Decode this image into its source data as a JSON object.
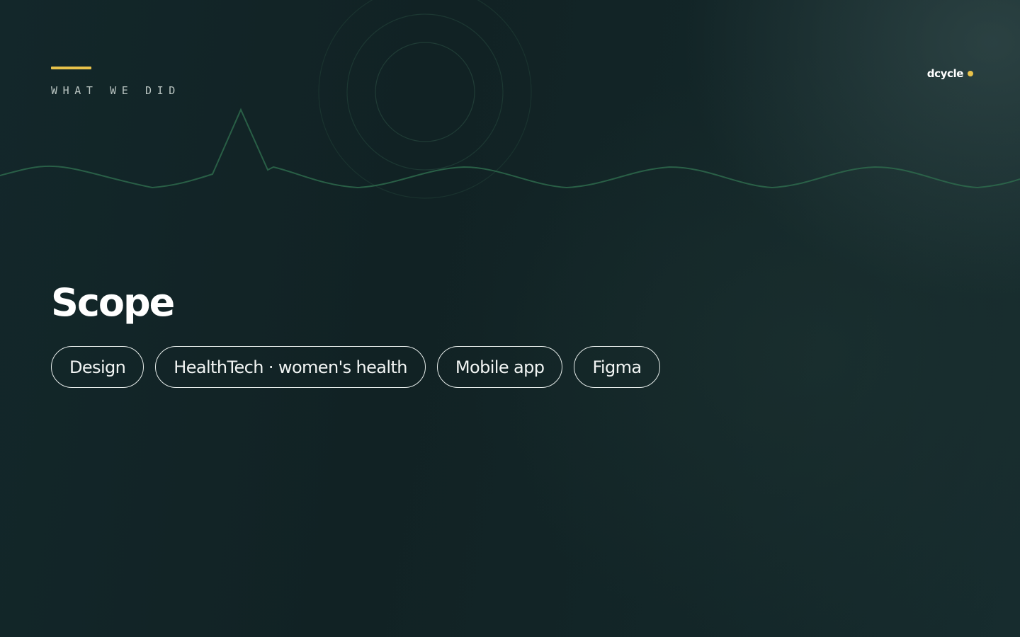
{
  "slide": {
    "eyebrow": "WHAT WE DID",
    "title": "Scope",
    "tags": [
      {
        "label": "Design"
      },
      {
        "label": "HealthTech · women's health"
      },
      {
        "label": "Mobile app"
      },
      {
        "label": "Figma"
      }
    ]
  },
  "brand": {
    "name": "dcycle"
  },
  "colors": {
    "accent": "#e8c24a",
    "wave": "#2e6a4c",
    "rings": "#25463c",
    "background": "#122224",
    "text": "#ffffff",
    "eyebrow_text": "#b9c4c1",
    "tag_border": "#e6ecea"
  },
  "icons": {
    "brand_mark": "brand-dot-icon",
    "decor_rings": "concentric-rings-icon",
    "decor_wave": "heartbeat-wave-icon"
  }
}
